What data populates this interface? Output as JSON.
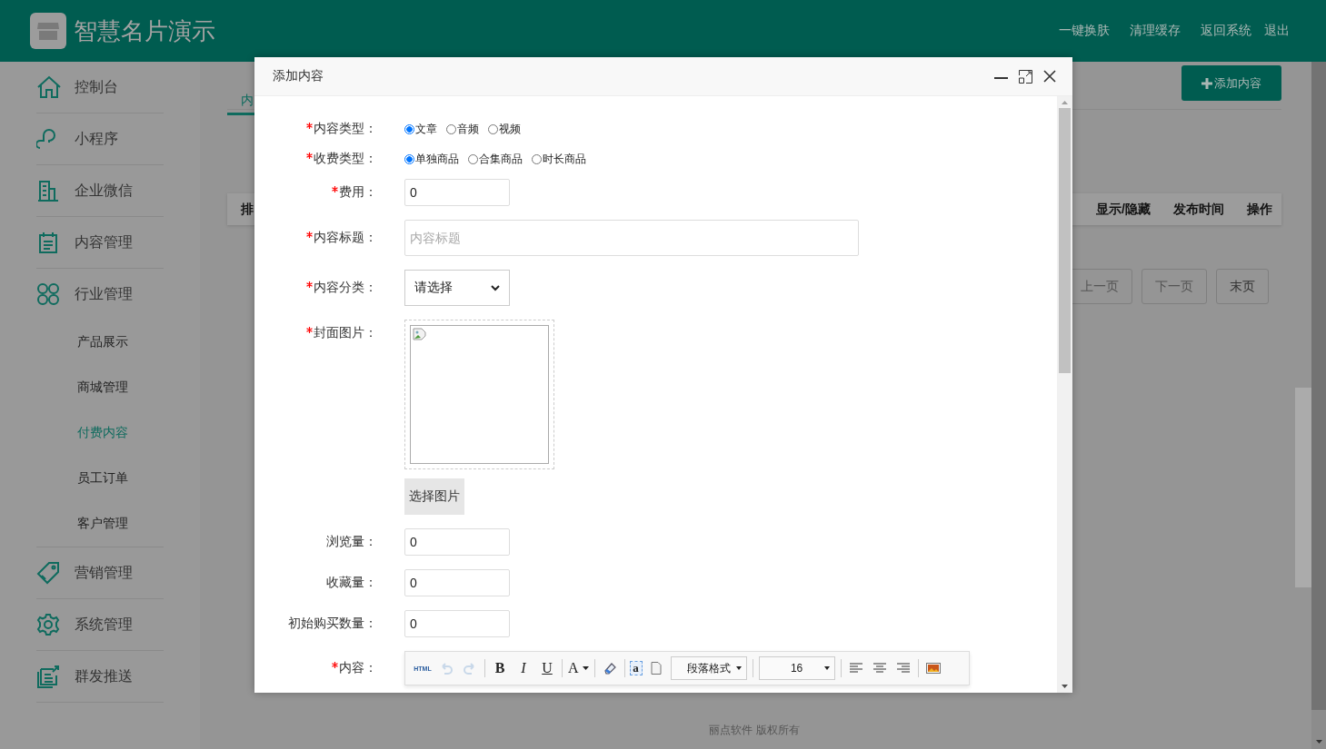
{
  "header": {
    "title": "智慧名片演示",
    "links": [
      "一键换肤",
      "清理缓存",
      "返回系统",
      "退出"
    ]
  },
  "sidebar": {
    "items": [
      {
        "label": "控制台",
        "kind": "home",
        "selected": false
      },
      {
        "label": "小程序",
        "kind": "link",
        "selected": false
      },
      {
        "label": "企业微信",
        "kind": "building",
        "selected": false
      },
      {
        "label": "内容管理",
        "kind": "clipboard",
        "selected": false
      },
      {
        "label": "行业管理",
        "kind": "grid",
        "selected": false,
        "children": [
          {
            "label": "产品展示",
            "selected": false
          },
          {
            "label": "商城管理",
            "selected": false
          },
          {
            "label": "付费内容",
            "selected": true
          },
          {
            "label": "员工订单",
            "selected": false
          },
          {
            "label": "客户管理",
            "selected": false
          }
        ]
      },
      {
        "label": "营销管理",
        "kind": "tag",
        "selected": false
      },
      {
        "label": "系统管理",
        "kind": "gear",
        "selected": false
      },
      {
        "label": "群发推送",
        "kind": "send",
        "selected": false
      }
    ]
  },
  "main": {
    "tabs": [
      {
        "label": "内",
        "selected": true
      }
    ],
    "add_button": "添加内容",
    "table": {
      "columns": [
        "排",
        "显示/隐藏",
        "发布时间",
        "操作"
      ]
    },
    "pagination": [
      {
        "label": "上一页",
        "disabled": true
      },
      {
        "label": "下一页",
        "disabled": true
      },
      {
        "label": "末页",
        "disabled": false
      }
    ]
  },
  "footer": "丽点软件 版权所有",
  "dialog": {
    "title": "添加内容",
    "fields": [
      {
        "kind": "radio",
        "label": "内容类型：",
        "required": true,
        "options": [
          {
            "label": "文章",
            "selected": true
          },
          {
            "label": "音频",
            "selected": false
          },
          {
            "label": "视频",
            "selected": false
          }
        ]
      },
      {
        "kind": "radio",
        "label": "收费类型：",
        "required": true,
        "options": [
          {
            "label": "单独商品",
            "selected": true
          },
          {
            "label": "合集商品",
            "selected": false
          },
          {
            "label": "时长商品",
            "selected": false
          }
        ]
      },
      {
        "kind": "number",
        "label": "费用：",
        "required": true,
        "value": "0"
      },
      {
        "kind": "text",
        "label": "内容标题：",
        "required": true,
        "placeholder": "内容标题"
      },
      {
        "kind": "select",
        "label": "内容分类：",
        "required": true,
        "value": "请选择"
      },
      {
        "kind": "image",
        "label": "封面图片：",
        "required": true,
        "button": "选择图片"
      },
      {
        "kind": "number",
        "label": "浏览量：",
        "required": false,
        "value": "0"
      },
      {
        "kind": "number",
        "label": "收藏量：",
        "required": false,
        "value": "0"
      },
      {
        "kind": "number",
        "label": "初始购买数量：",
        "required": false,
        "value": "0"
      },
      {
        "kind": "editor",
        "label": "内容：",
        "required": true,
        "toolbar": [
          {
            "kind": "html",
            "label": "HTML",
            "disabled": false
          },
          {
            "kind": "undo",
            "disabled": true
          },
          {
            "kind": "redo",
            "disabled": true
          },
          {
            "kind": "separator"
          },
          {
            "kind": "bold",
            "label": "B",
            "disabled": false
          },
          {
            "kind": "italic",
            "label": "I",
            "disabled": false
          },
          {
            "kind": "underline",
            "label": "U",
            "disabled": false
          },
          {
            "kind": "separator"
          },
          {
            "kind": "color",
            "label": "A",
            "disabled": false
          },
          {
            "kind": "separator"
          },
          {
            "kind": "eraser",
            "disabled": false
          },
          {
            "kind": "separator"
          },
          {
            "kind": "highlight",
            "label": "a",
            "disabled": false
          },
          {
            "kind": "page",
            "disabled": false
          },
          {
            "kind": "select",
            "label": "段落格式",
            "disabled": false
          },
          {
            "kind": "separator"
          },
          {
            "kind": "select",
            "label": "16",
            "disabled": false
          },
          {
            "kind": "separator"
          },
          {
            "kind": "align-left",
            "disabled": false
          },
          {
            "kind": "align-center",
            "disabled": false
          },
          {
            "kind": "align-right",
            "disabled": false
          },
          {
            "kind": "separator"
          },
          {
            "kind": "image",
            "disabled": false
          }
        ]
      }
    ]
  }
}
